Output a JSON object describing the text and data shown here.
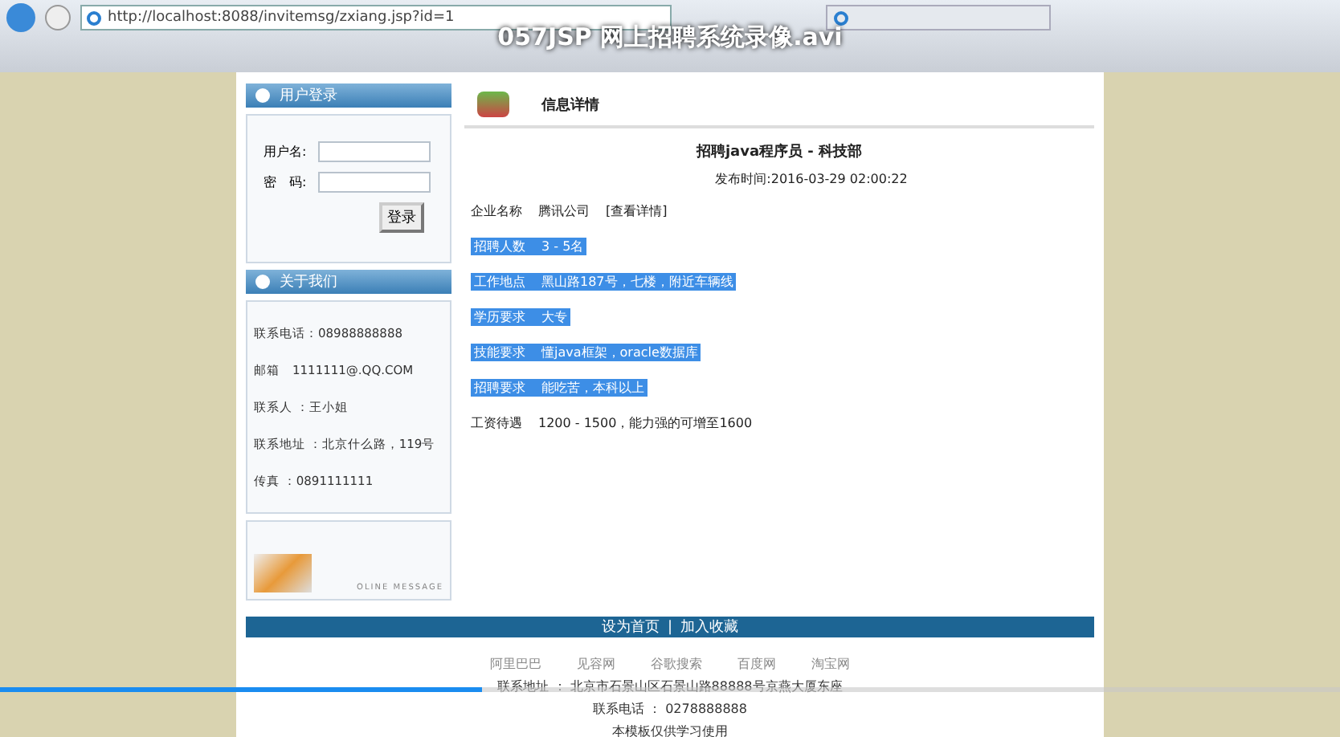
{
  "video": {
    "title": "057JSP 网上招聘系统录像.avi",
    "level": 0.36
  },
  "browser": {
    "url": "http://localhost:8088/invitemsg/zxiang.jsp?id=1"
  },
  "login": {
    "title": "用户登录",
    "fields": [
      {
        "label": "用户名:"
      },
      {
        "label": "密　码:"
      }
    ],
    "button": "登录"
  },
  "about": {
    "title": "关于我们",
    "items": [
      "联系电话：08988888888",
      "邮箱　1111111@.QQ.COM",
      "联系人 ：王小姐",
      "联系地址 ：北京什么路，119号",
      "传真 ：0891111111"
    ]
  },
  "banner": {
    "caption": "OLINE MESSAGE"
  },
  "detail": {
    "heading": "信息详情",
    "title": "招聘java程序员 - 科技部",
    "published": "发布时间:2016-03-29 02:00:22",
    "company_label": "企业名称",
    "company": "腾讯公司",
    "company_link": "[查看详情]",
    "rows": [
      {
        "label": "招聘人数",
        "value": "3 - 5名",
        "selected": true
      },
      {
        "label": "工作地点",
        "value": "黑山路187号，七楼，附近车辆线",
        "selected": true
      },
      {
        "label": "学历要求",
        "value": "大专",
        "selected": true
      },
      {
        "label": "技能要求",
        "value": "懂java框架，oracle数据库",
        "selected": true
      },
      {
        "label": "招聘要求",
        "value": "能吃苦，本科以上",
        "selected": true
      },
      {
        "label": "工资待遇",
        "value": "1200 - 1500，能力强的可增至1600",
        "selected": false
      }
    ]
  },
  "footer": {
    "links": [
      "设为首页",
      "加入收藏"
    ],
    "separator": "|",
    "partners": [
      "阿里巴巴",
      "见容网",
      "谷歌搜索",
      "百度网",
      "淘宝网"
    ],
    "address": "联系地址 ： 北京市石景山区石景山路88888号京燕大厦东座",
    "phone": "联系电话 ： 0278888888",
    "note": "本模板仅供学习使用"
  }
}
